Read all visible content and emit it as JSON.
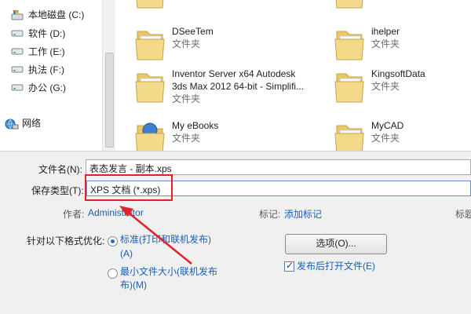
{
  "nav": {
    "drives": [
      {
        "label": "本地磁盘 (C:)",
        "icon": "windows-drive-icon"
      },
      {
        "label": "软件 (D:)",
        "icon": "hard-drive-icon"
      },
      {
        "label": "工作 (E:)",
        "icon": "hard-drive-icon"
      },
      {
        "label": "执法 (F:)",
        "icon": "hard-drive-icon"
      },
      {
        "label": "办公 (G:)",
        "icon": "hard-drive-icon"
      }
    ],
    "network_label": "网络"
  },
  "files": [
    {
      "name": "",
      "type": "文件夹"
    },
    {
      "name": "",
      "type": "文件夹"
    },
    {
      "name": "DSeeTem",
      "type": "文件夹"
    },
    {
      "name": "ihelper",
      "type": "文件夹"
    },
    {
      "name": "Inventor Server x64 Autodesk\n3ds Max 2012 64-bit - Simplifi...",
      "type": "文件夹"
    },
    {
      "name": "KingsoftData",
      "type": "文件夹"
    },
    {
      "name": "My eBooks",
      "type": "文件夹"
    },
    {
      "name": "MyCAD",
      "type": "文件夹"
    }
  ],
  "dialog": {
    "filename_label": "文件名(N):",
    "filename_value": "表态发言 - 副本.xps",
    "savetype_label": "保存类型(T):",
    "savetype_value": "XPS 文档 (*.xps)",
    "author_label": "作者:",
    "author_value": "Administrator",
    "tags_label": "标记:",
    "tags_value": "添加标记",
    "title_label": "标题",
    "optimize_label": "针对以下格式优化:",
    "option_standard_line1": "标准(打印和联机发布)",
    "option_standard_line2": "(A)",
    "option_min_line1": "最小文件大小(联机发布",
    "option_min_line2": "布)(M)",
    "options_button": "选项(O)...",
    "open_after_publish": "发布后打开文件(E)"
  },
  "colors": {
    "annotation": "#e0232a",
    "link": "#1a5fb4"
  }
}
